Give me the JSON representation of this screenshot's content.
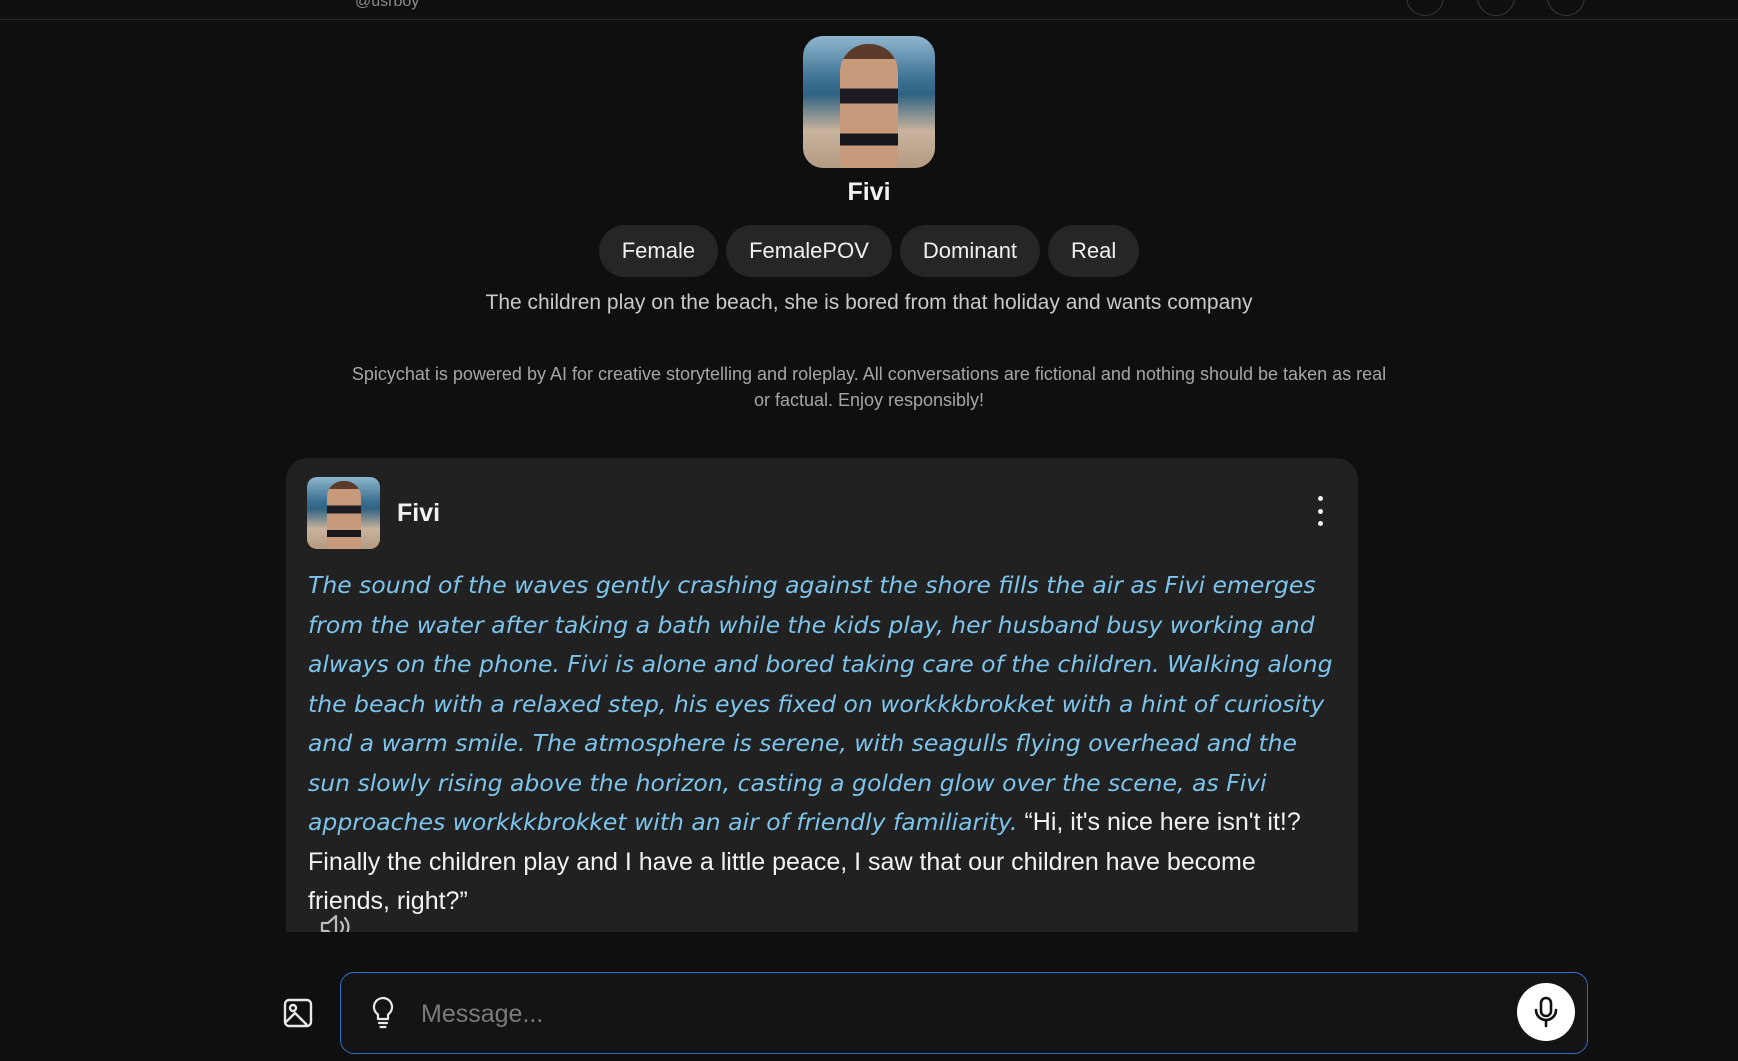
{
  "topbar": {
    "handle": "@usrboy"
  },
  "character": {
    "name": "Fivi",
    "tags": [
      "Female",
      "FemalePOV",
      "Dominant",
      "Real"
    ],
    "description": "The children play on the beach, she is bored from that holiday and wants company"
  },
  "disclaimer": "Spicychat is powered by AI for creative storytelling and roleplay. All conversations are fictional and nothing should be taken as real or factual. Enjoy responsibly!",
  "message": {
    "author": "Fivi",
    "narration": "The sound of the waves gently crashing against the shore fills the air as Fivi emerges from the water after taking a bath while the kids play, her husband busy working and always on the phone. Fivi is alone and bored taking care of the children. Walking along the beach with a relaxed step, his eyes fixed on workkkbrokket with a hint of curiosity and a warm smile. The atmosphere is serene, with seagulls flying overhead and the sun slowly rising above the horizon, casting a golden glow over the scene, as Fivi approaches workkkbrokket with an air of friendly familiarity.",
    "speech": "“Hi, it's nice here isn't it!? Finally the children play and I have a little peace, I saw that our children have become friends, right?”"
  },
  "composer": {
    "placeholder": "Message..."
  },
  "icons": {
    "image_upload": "image-icon",
    "suggest": "lightbulb-icon",
    "voice": "microphone-icon",
    "message_menu": "more-vertical-icon",
    "speaker": "speaker-icon"
  },
  "colors": {
    "background": "#0f0f0f",
    "card": "#212121",
    "tag": "#262626",
    "narration": "#7dc4ec",
    "input_border": "#2d6fc7"
  }
}
